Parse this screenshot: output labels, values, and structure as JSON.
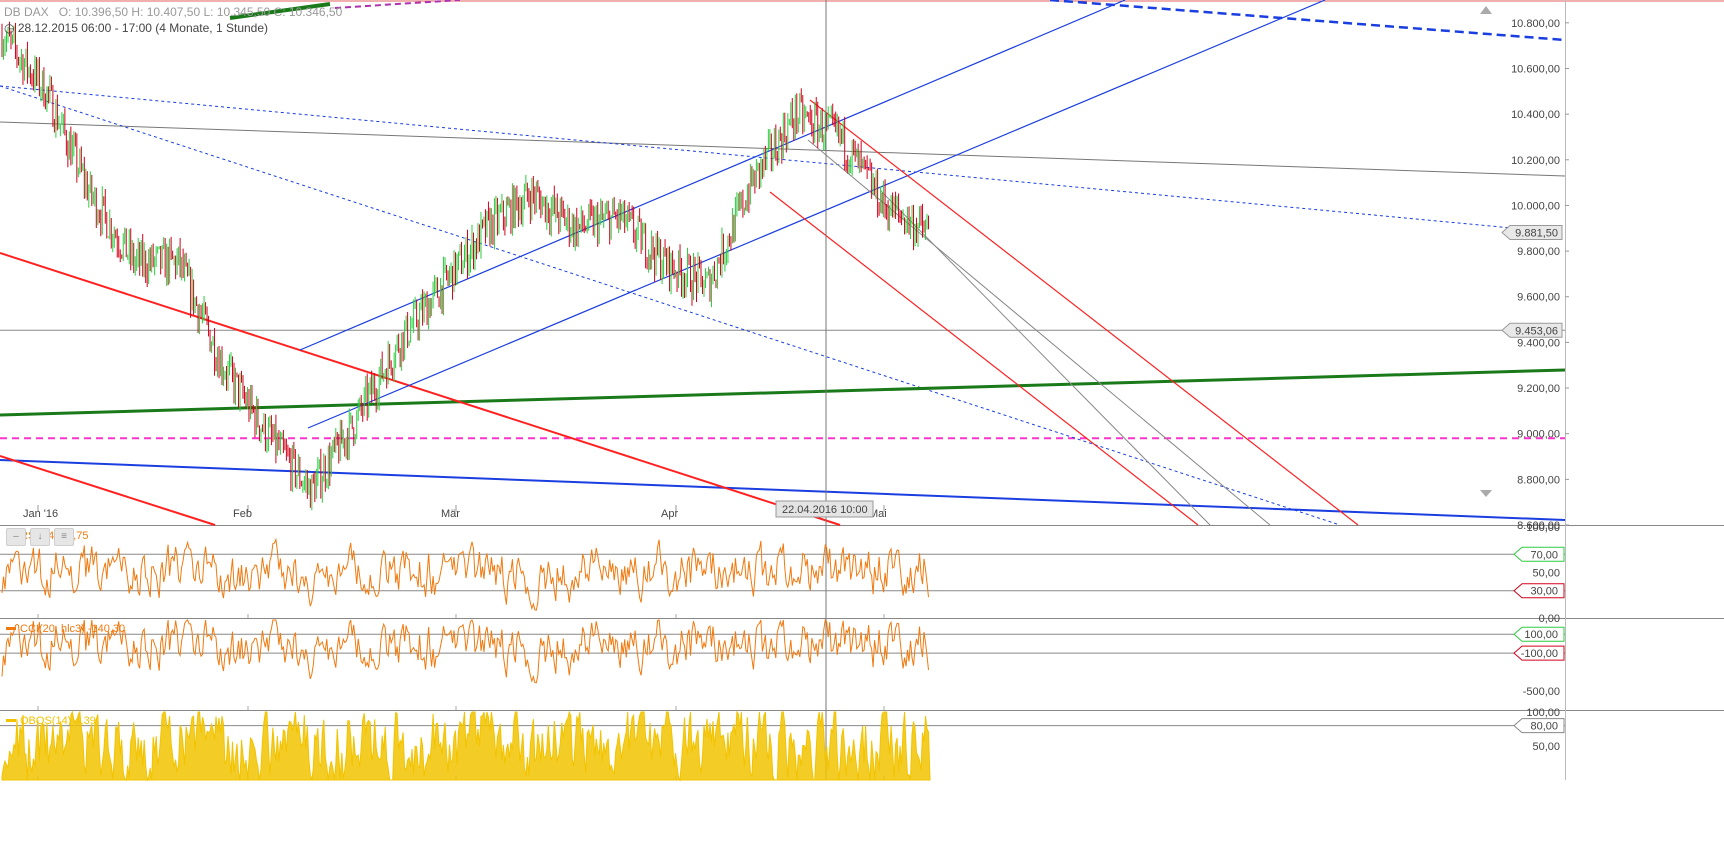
{
  "header": {
    "symbol": "DB DAX",
    "ohlc": "O: 10.396,50  H: 10.407,50  L: 10.345,50  C: 10.346,50",
    "range_label": "28.12.2015 06:00 - 17:00 (4 Monate, 1 Stunde)"
  },
  "crosshair_label": "22.04.2016 10:00",
  "colors": {
    "up": "#2ecc40",
    "down": "#d0021b",
    "trend_red": "#ff2020",
    "trend_blue": "#1a3ee0",
    "green_line": "#1a7a1a",
    "magenta": "#ff33cc",
    "rsi": "#f07a10",
    "obos": "#f2c300"
  },
  "chart_data": [
    {
      "type": "line",
      "title": "DB DAX",
      "ylim": [
        8600,
        10900
      ],
      "y_ticks": [
        "10.800,00",
        "10.600,00",
        "10.400,00",
        "10.200,00",
        "10.000,00",
        "9.800,00",
        "9.600,00",
        "9.400,00",
        "9.200,00",
        "9.000,00",
        "8.800,00",
        "8.600,00"
      ],
      "x_ticks": [
        "Jan '16",
        "Feb",
        "Mär",
        "Apr",
        "Mai"
      ],
      "price_markers": [
        {
          "label": "9.881,50",
          "value": 9881.5
        },
        {
          "label": "9.453,06",
          "value": 9453.06
        }
      ],
      "x": [
        "28.12.2015",
        "04.01.2016",
        "11.01.2016",
        "18.01.2016",
        "25.01.2016",
        "01.02.2016",
        "08.02.2016",
        "11.02.2016",
        "15.02.2016",
        "22.02.2016",
        "29.02.2016",
        "07.03.2016",
        "14.03.2016",
        "21.03.2016",
        "28.03.2016",
        "04.04.2016",
        "11.04.2016",
        "18.04.2016",
        "22.04.2016",
        "25.04.2016",
        "02.05.2016",
        "06.05.2016"
      ],
      "series": [
        {
          "values": [
            10750,
            10500,
            10050,
            9750,
            9750,
            9300,
            9000,
            8750,
            9050,
            9400,
            9650,
            9900,
            10050,
            9900,
            9950,
            9750,
            9650,
            10100,
            10400,
            10300,
            10000,
            9880
          ]
        }
      ]
    },
    {
      "type": "line",
      "title": "RSI(14)",
      "value_label": "40,75",
      "ylim": [
        0,
        100
      ],
      "y_ticks": [
        "100,00",
        "50,00",
        "0,00"
      ],
      "levels": [
        {
          "label": "70,00",
          "value": 70
        },
        {
          "label": "30,00",
          "value": 30
        }
      ]
    },
    {
      "type": "line",
      "title": "CCI(20, hlc3)",
      "value_label": "-140,30",
      "ylim": [
        -700,
        250
      ],
      "y_ticks": [
        "-500,00"
      ],
      "levels": [
        {
          "label": "100,00",
          "value": 100
        },
        {
          "label": "-100,00",
          "value": -100
        }
      ]
    },
    {
      "type": "area",
      "title": "OBOS(14)",
      "value_label": "4,39",
      "ylim": [
        0,
        100
      ],
      "y_ticks": [
        "100,00",
        "50,00"
      ],
      "levels": [
        {
          "label": "80,00",
          "value": 80
        }
      ]
    }
  ]
}
